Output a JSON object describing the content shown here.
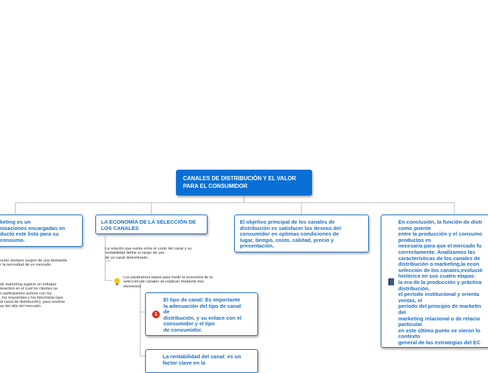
{
  "root": {
    "title": "CANALES DE DISTRIBUCIÓN Y EL VALOR PARA EL CONSUMIDOR"
  },
  "branches": {
    "left": "keting es un\nnizaciones encargadas en\nducto este listo para su\n consumo.",
    "economia": "LA ECONOMÍA DE LA SELECCIÓN DE\nLOS CANALES",
    "objetivo": "El objetivo principal de los canales de\ndistribución es satisfacer los deseos del\nconsumidor en optimas condiciones de\nlugar, tiempo, costo, calidad, precio y\npresentación.",
    "conclusion": "En conclusión, la función de distr\ncomo puente\nentre la producción y el consumo\nproductos es\nnecesaria para que el mercado fu\ncorrectamente. Analizamos las\ncaracterísticas de los canales de\ndistribución o marketing,la econ\nselección de los canales,evolució\nhistórica en sus cuatro etapas:\nla era de la producción y práctica\ndistribución,\nel período institucional y orienta\nventas, el\nperíodo del principio de marketin\ndel\nmarketing relacional o de relacio\nparticular\nen este último punto se vieron lo\ncontexto\ngeneral de las estrategias del EC"
  },
  "sub_nodes": {
    "tipo": "El tipo de canal: Es importante\nla adecuación del tipo de canal\nde\ndistribución, y su enlace con el\nconsumidor y el tipo\nde consumidor.",
    "rentabilidad": "La rentabilidad del canal: es un\nfactor clave en la"
  },
  "notes": {
    "left_1": "ución siempre surgen de una demanda\nr la necesidad de un mercado.",
    "left_2": "de marketing sugiere un enfoque\nteractivo en el cual los clientes se\nn participantes activos con los\n, los mayoristas y los minoristas (que\nel canal de distribución), para resolver\nas del sitio del mercado.",
    "relacion": "La relación que existe entre el costo del canal y su\nrentabilidad define el rango de uso\nde un canal determinado.",
    "parametros": "Los parámetros bases para medir la economía de la\nselección de canales se explican mediante tres\nelementos"
  },
  "icons": {
    "tipo_badge": "1",
    "colors": {
      "accent": "#1a6fc4",
      "root": "#0a6fd4",
      "badge": "#d9342b"
    }
  }
}
